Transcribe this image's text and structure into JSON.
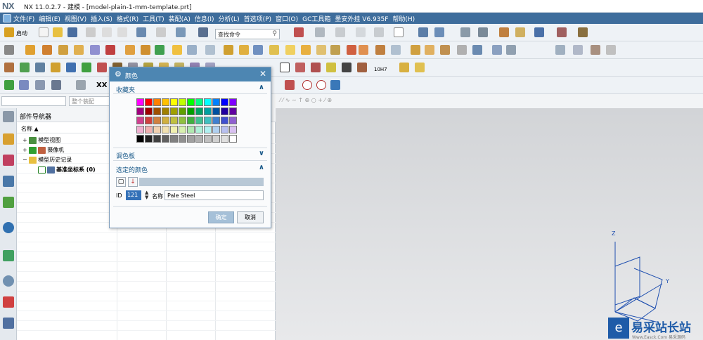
{
  "app": {
    "logo": "NX",
    "title": "NX 11.0.2.7 - 建模 - [model-plain-1-mm-template.prt]"
  },
  "menu": [
    "文件(F)",
    "编辑(E)",
    "视图(V)",
    "插入(S)",
    "格式(R)",
    "工具(T)",
    "装配(A)",
    "信息(I)",
    "分析(L)",
    "首选项(P)",
    "窗口(O)",
    "GC工具箱",
    "墨安外挂 V6.935F",
    "帮助(H)"
  ],
  "toolbar": {
    "start_label": "启动",
    "search_placeholder": "查找命令",
    "xx_label": "XX",
    "fit_label": "10H7"
  },
  "filter": {
    "selection_placeholder": "整个装配"
  },
  "navigator": {
    "title": "部件导航器",
    "column_name": "名称",
    "items": [
      "模型视图",
      "摄像机",
      "模型历史记录",
      "基准坐标系 (0)"
    ]
  },
  "dialog": {
    "title": "颜色",
    "favorites_label": "收藏夹",
    "palette_label": "调色板",
    "selected_color_label": "选定的颜色",
    "id_label": "ID",
    "id_value": "121",
    "name_label": "名称",
    "name_value": "Pale Steel",
    "ok_label": "确定",
    "cancel_label": "取消",
    "swatches": [
      [
        "#ff00ff",
        "#ff0000",
        "#ff8000",
        "#ffc000",
        "#ffff00",
        "#c0ff00",
        "#00ff00",
        "#00ff80",
        "#00ffff",
        "#0080ff",
        "#0000ff",
        "#8000ff"
      ],
      [
        "#a0007f",
        "#a00000",
        "#a05000",
        "#a08000",
        "#a0a000",
        "#60a000",
        "#00a000",
        "#00a060",
        "#00a0a0",
        "#0050a0",
        "#2000a0",
        "#6000a0"
      ],
      [
        "#d04090",
        "#d04040",
        "#d08040",
        "#d0b040",
        "#c0c040",
        "#90c040",
        "#40b040",
        "#40c090",
        "#40c0c0",
        "#4080d0",
        "#4050d0",
        "#9060d0"
      ],
      [
        "#f0b0d0",
        "#f0b0b0",
        "#f0d0b0",
        "#f0e0b0",
        "#f0f0b0",
        "#d8f0b0",
        "#b0e8b0",
        "#b0f0d8",
        "#b0f0f0",
        "#b0d0f0",
        "#b8c0f0",
        "#d8c0f0"
      ],
      [
        "#000000",
        "#202020",
        "#404040",
        "#606060",
        "#808080",
        "#909090",
        "#a0a0a0",
        "#b0b0b0",
        "#c0c0c0",
        "#d0d0d0",
        "#e0e0e0",
        "#ffffff"
      ]
    ],
    "selected_color": "#b8c8d6"
  },
  "axes": {
    "z": "Z",
    "y": "Y"
  },
  "watermark": {
    "icon": "e",
    "text": "易采站长站",
    "sub": "Www.Easck.Com  易采源码"
  }
}
